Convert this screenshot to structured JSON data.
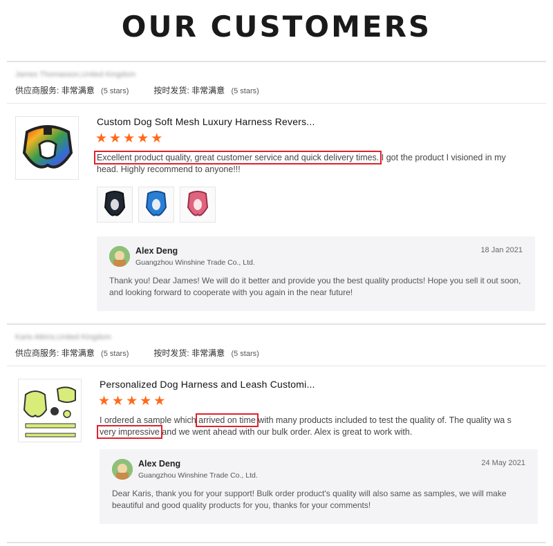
{
  "title": "OUR CUSTOMERS",
  "reviews": [
    {
      "reviewer": "James Thomasson,United Kingdom",
      "service_label": "供应商服务:",
      "service_value": "非常满意",
      "service_stars": "(5 stars)",
      "ship_label": "按时发货:",
      "ship_value": "非常满意",
      "ship_stars": "(5 stars)",
      "product_title": "Custom Dog Soft Mesh Luxury Harness Revers...",
      "rating": 5,
      "text_highlight": "Excellent product quality, great customer service and quick delivery times.",
      "text_rest": " I got the product I visioned in my head. Highly recommend to anyone!!!",
      "reply": {
        "name": "Alex Deng",
        "company": "Guangzhou Winshine Trade Co., Ltd.",
        "date": "18 Jan 2021",
        "text": "Thank you! Dear James! We will do it better and provide you  the best quality products! Hope you sell it out soon, and looking forward to cooperate with you again in the near future!"
      }
    },
    {
      "reviewer": "Karis Atkins,United Kingdom",
      "service_label": "供应商服务:",
      "service_value": "非常满意",
      "service_stars": "(5 stars)",
      "ship_label": "按时发货:",
      "ship_value": "非常满意",
      "ship_stars": "(5 stars)",
      "product_title": "Personalized Dog Harness and Leash Customi...",
      "rating": 5,
      "text_a": "I ordered a sample which ",
      "text_hl1": "arrived on time",
      "text_b": " with many products included to test the quality of. The quality wa s ",
      "text_hl2": "very impressive",
      "text_c": " and we went ahead with our bulk order. Alex is great to work with.",
      "reply": {
        "name": "Alex Deng",
        "company": "Guangzhou Winshine Trade Co., Ltd.",
        "date": "24 May 2021",
        "text": "Dear Karis, thank you for your support!  Bulk order product's quality will also same as samples, we will make beautiful and good quality products for you, thanks for your comments!"
      }
    }
  ],
  "colors": {
    "star": "#ff6a1a",
    "highlight": "#e0202a",
    "reply_bg": "#f4f4f6"
  },
  "icons": [
    "star-icon",
    "avatar",
    "harness-image"
  ]
}
